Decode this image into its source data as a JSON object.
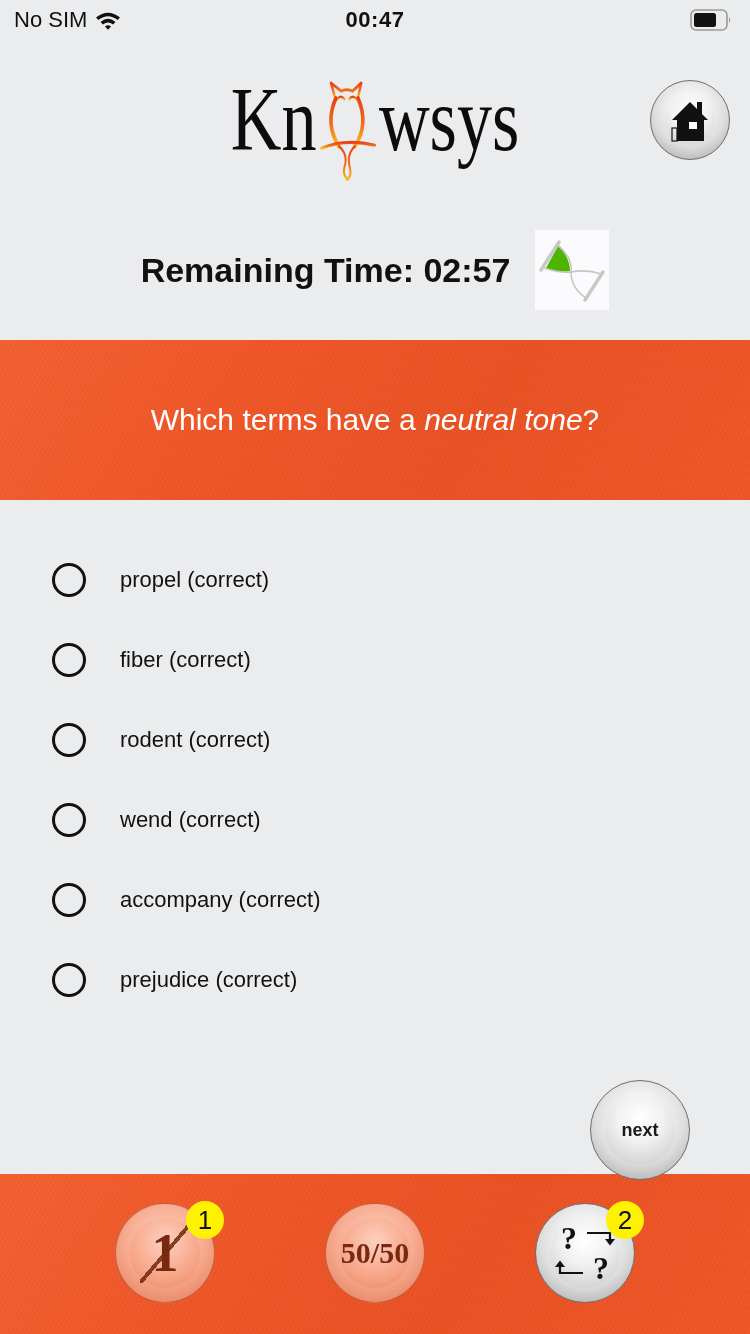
{
  "status_bar": {
    "carrier": "No SIM",
    "time": "00:47"
  },
  "header": {
    "logo_start": "Kn",
    "logo_end": "wsys"
  },
  "timer": {
    "label": "Remaining Time: 02:57"
  },
  "question": {
    "text": "Which terms have a *neutral tone*?"
  },
  "options": [
    {
      "label": "propel (correct)",
      "selected": false
    },
    {
      "label": "fiber (correct)",
      "selected": false
    },
    {
      "label": "rodent (correct)",
      "selected": false
    },
    {
      "label": "wend (correct)",
      "selected": false
    },
    {
      "label": "accompany (correct)",
      "selected": false
    },
    {
      "label": "prejudice (correct)",
      "selected": false
    }
  ],
  "next_button": {
    "label": "next"
  },
  "lifelines": [
    {
      "kind": "eliminate",
      "label": "1",
      "badge": "1",
      "disabled": true
    },
    {
      "kind": "fifty",
      "label": "50/50",
      "disabled": true
    },
    {
      "kind": "swap",
      "marks": [
        "?",
        "?"
      ],
      "badge": "2",
      "disabled": false
    }
  ]
}
